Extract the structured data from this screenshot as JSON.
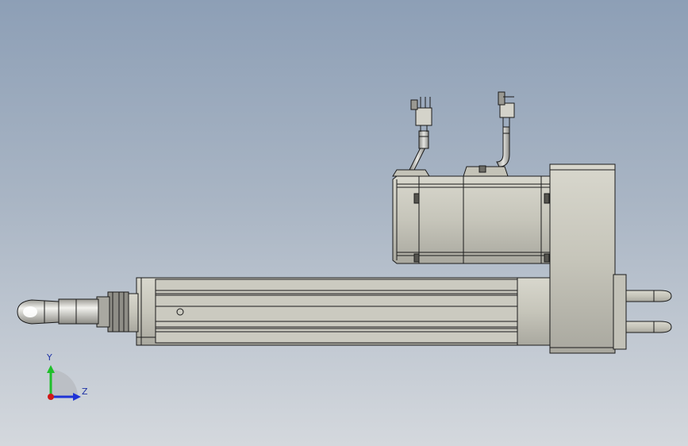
{
  "viewport": {
    "background_top": "#8d9fb6",
    "background_bottom": "#d4d8dd"
  },
  "model": {
    "body_color": "#c9c8bd",
    "edge_color": "#1b1b1b",
    "parts": [
      "actuator-body",
      "rod-end-clevis",
      "servo-motor",
      "motor-cable",
      "encoder-cable",
      "connector",
      "belt-housing",
      "rear-clevis-mount"
    ]
  },
  "triad": {
    "y_label": "Y",
    "z_label": "Z",
    "y_color": "#1fbf2a",
    "z_color": "#1f33d6",
    "x_color": "#d01818"
  }
}
